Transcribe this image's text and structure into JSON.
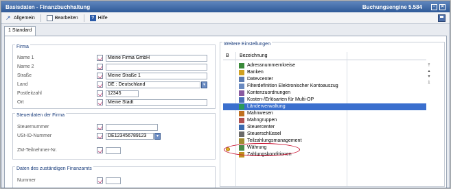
{
  "window": {
    "title": "Basisdaten - Finanzbuchhaltung",
    "engine": "Buchungsengine 5.584",
    "controls": [
      "pin-icon",
      "close-icon"
    ]
  },
  "menu": {
    "allgemein": "Allgemein",
    "bearbeiten": "Bearbeiten",
    "hilfe": "Hilfe"
  },
  "tabs": [
    {
      "label": "1 Standard"
    }
  ],
  "firma": {
    "title": "Firma",
    "fields": [
      {
        "label": "Name 1",
        "value": "Meine Firma GmbH"
      },
      {
        "label": "Name 2",
        "value": ""
      },
      {
        "label": "Straße",
        "value": "Meine Straße 1"
      },
      {
        "label": "Land",
        "value": "DE    : Deutschland"
      },
      {
        "label": "Postleitzahl",
        "value": "12345"
      },
      {
        "label": "Ort",
        "value": "Meine Stadt"
      }
    ]
  },
  "steuer": {
    "title": "Steuerdaten der Firma",
    "fields": [
      {
        "label": "Steuernummer",
        "value": ""
      },
      {
        "label": "USt-ID-Nummer",
        "value": "DE123456789123"
      },
      {
        "label": "ZM-Teilnehmer-Nr.",
        "value": ""
      }
    ]
  },
  "finanzamt": {
    "title": "Daten des zuständigen Finanzamts",
    "fields": [
      {
        "label": "Nummer",
        "value": ""
      }
    ]
  },
  "weitere": {
    "title": "Weitere Einstellungen",
    "header_b": "B",
    "header_bezeichnung": "Bezeichnung",
    "items": [
      {
        "label": "Adressnummernkreise",
        "icon": "address-ranges-icon",
        "color": "#3a8a3a"
      },
      {
        "label": "Banken",
        "icon": "bank-icon",
        "color": "#d0a020"
      },
      {
        "label": "Datevcenter",
        "icon": "datev-icon",
        "color": "#5a7ab0"
      },
      {
        "label": "Filterdefinition Elektronischer Kontoauszug",
        "icon": "filter-icon",
        "color": "#6a8ac0"
      },
      {
        "label": "Kontenzuordnungen",
        "icon": "account-mapping-icon",
        "color": "#8a5aa0"
      },
      {
        "label": "Kosten-/Erlösarten für Multi-OP",
        "icon": "cost-types-icon",
        "color": "#4a70b8"
      },
      {
        "label": "Länderverwaltung",
        "icon": "globe-icon",
        "color": "#2a9a5a"
      },
      {
        "label": "Mahnwesen",
        "icon": "dunning-icon",
        "color": "#c07020"
      },
      {
        "label": "Mahngruppen",
        "icon": "dunning-groups-icon",
        "color": "#b05050"
      },
      {
        "label": "Steuercenter",
        "icon": "tax-center-icon",
        "color": "#3a6ab0"
      },
      {
        "label": "Steuerschlüssel",
        "icon": "tax-key-icon",
        "color": "#6a6a6a"
      },
      {
        "label": "Teilzahlungsmanagement",
        "icon": "installment-icon",
        "color": "#a08a30"
      },
      {
        "label": "Währung",
        "icon": "currency-icon",
        "color": "#4a8a4a"
      },
      {
        "label": "Zahlungskonditionen",
        "icon": "payment-terms-icon",
        "color": "#c09020"
      }
    ],
    "selected_index": 6
  }
}
